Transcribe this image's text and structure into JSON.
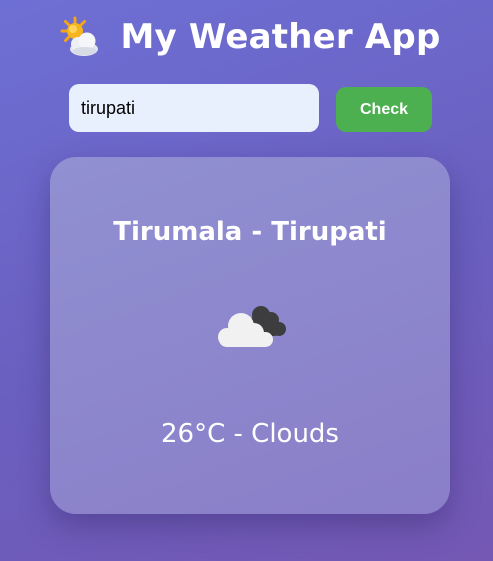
{
  "header": {
    "icon": "sun-behind-cloud-icon",
    "title": "My Weather App"
  },
  "search": {
    "value": "tirupati",
    "button_label": "Check"
  },
  "weather": {
    "city": "Tirumala - Tirupati",
    "icon": "cloud-icon",
    "temperature_description": "26°C - Clouds"
  },
  "colors": {
    "background_start": "#6e6fd4",
    "background_end": "#7458b4",
    "button": "#4caf50",
    "card": "#8f88cf",
    "text": "#ffffff"
  }
}
